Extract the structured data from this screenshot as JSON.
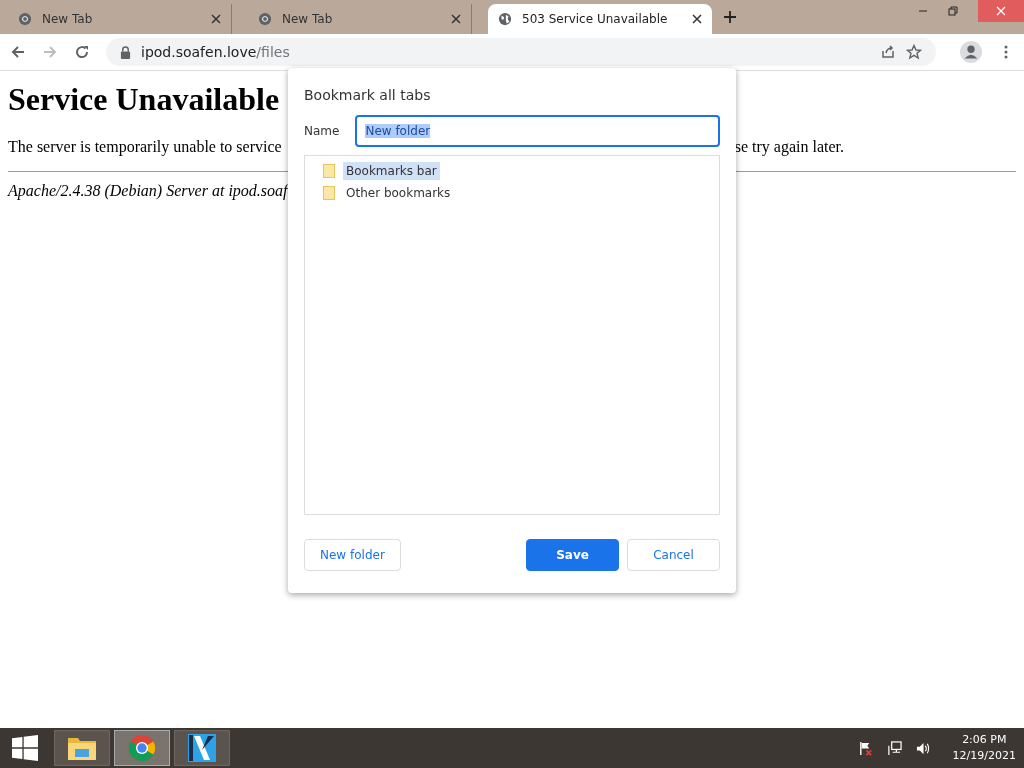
{
  "tabs": [
    {
      "title": "New Tab",
      "kind": "chrome",
      "selected": false
    },
    {
      "title": "New Tab",
      "kind": "chrome",
      "selected": false
    },
    {
      "title": "503 Service Unavailable",
      "kind": "globe",
      "selected": true
    }
  ],
  "address_bar": {
    "host": "ipod.soafen.love",
    "path": "/files"
  },
  "page": {
    "heading": "Service Unavailable",
    "message_left": "The server is temporarily unable to service",
    "message_right": "se try again later.",
    "footer": "Apache/2.4.38 (Debian) Server at ipod.soaf"
  },
  "dialog": {
    "title": "Bookmark all tabs",
    "name_label": "Name",
    "name_value": "New folder",
    "folders": [
      {
        "label": "Bookmarks bar",
        "selected": true
      },
      {
        "label": "Other bookmarks",
        "selected": false
      }
    ],
    "buttons": {
      "new_folder": "New folder",
      "save": "Save",
      "cancel": "Cancel"
    }
  },
  "taskbar": {
    "apps": [
      {
        "kind": "explorer",
        "selected": false
      },
      {
        "kind": "chrome",
        "selected": true
      },
      {
        "kind": "video",
        "selected": false
      }
    ],
    "time": "2:06 PM",
    "date": "12/19/2021"
  }
}
